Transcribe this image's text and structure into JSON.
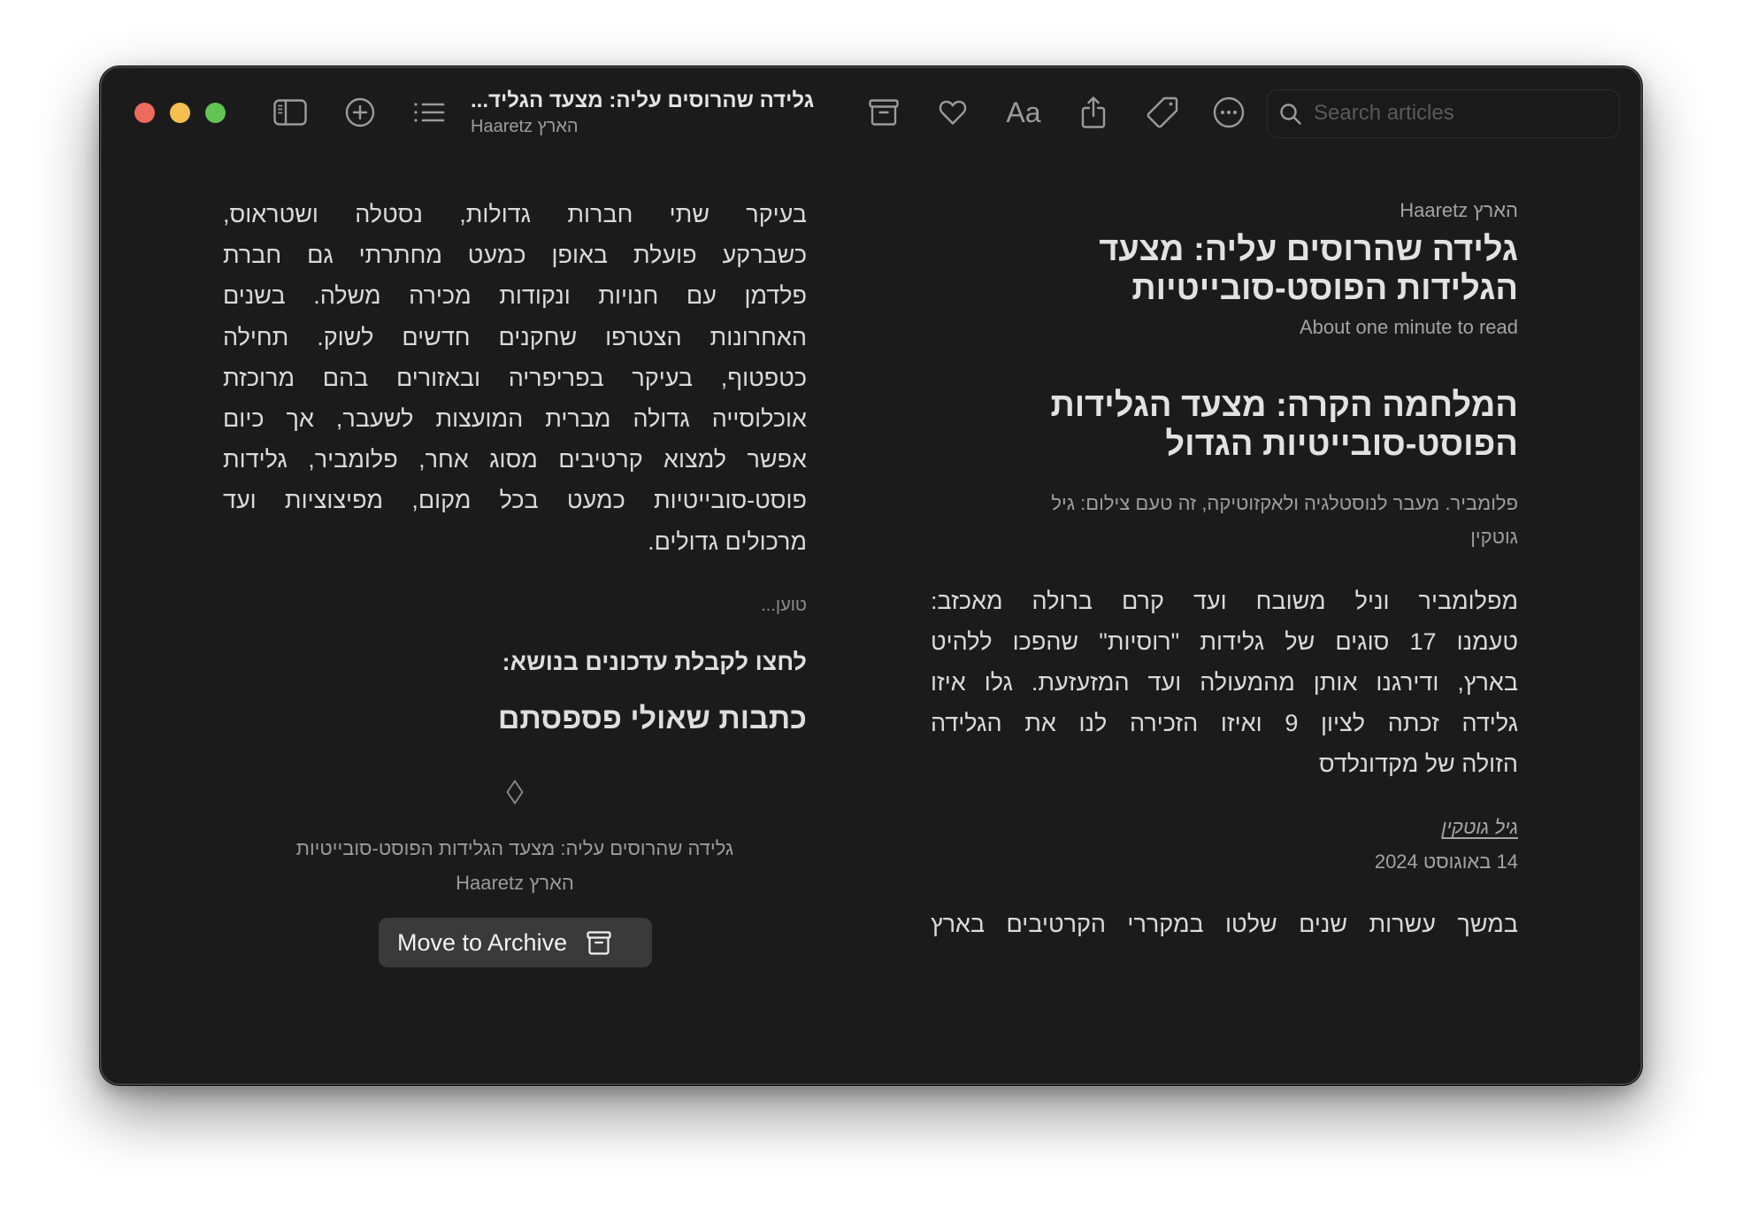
{
  "colors": {
    "window_bg": "#1b1b1b",
    "text_primary": "#dadada",
    "text_muted": "#9d9d9d",
    "icon": "#9b9b9b",
    "button_bg": "#3a3a3a",
    "traffic_close": "#ed6a5e",
    "traffic_minimize": "#f5bf4f",
    "traffic_zoom": "#61c554"
  },
  "toolbar": {
    "left_icons": [
      "sidebar-toggle-icon",
      "add-circle-icon",
      "list-icon"
    ],
    "title": "גלידה שהרוסים עליה: מצעד הגליד...",
    "subtitle": "הארץ Haaretz",
    "right_icons": [
      "archive-icon",
      "heart-icon",
      "text-size-icon",
      "share-icon",
      "tag-icon",
      "more-icon"
    ],
    "font_button_label": "Aa",
    "search": {
      "placeholder": "Search articles",
      "value": ""
    }
  },
  "article": {
    "source": "הארץ Haaretz",
    "title_lines": [
      "גלידה שהרוסים עליה: מצעד",
      "הגלידות הפוסט-סובייטיות"
    ],
    "read_time": "About one minute to read",
    "subheading_lines": [
      "המלחמה הקרה: מצעד הגלידות",
      "הפוסט-סובייטיות הגדול"
    ],
    "caption_lines": [
      "פלומביר. מעבר לנוסטלגיה ולאקזוטיקה, זה טעם צילום: גיל",
      "גוטקין"
    ],
    "intro_lines": [
      "מפלומביר וניל משובח ועד קרם ברולה מאכזב:",
      "טעמנו 17 סוגים של גלידות \"רוסיות\" שהפכו ללהיט",
      "בארץ, ודירגנו אותן מהמעולה ועד המזעזעת. גלו איזו",
      "גלידה זכתה לציון 9 ואיזו הזכירה לנו את הגלידה",
      "הזולה של מקדונלדס"
    ],
    "author": "גיל גוטקין",
    "date": "14 באוגוסט 2024",
    "body_lines": [
      "במשך עשרות שנים שלטו במקררי הקרטיבים בארץ",
      "בעיקר שתי חברות גדולות, נסטלה ושטראוס,",
      "כשברקע פועלת באופן כמעט מחתרתי גם חברת",
      "פלדמן עם חנויות ונקודות מכירה משלה. בשנים",
      "האחרונות הצטרפו שחקנים חדשים לשוק. תחילה",
      "כטפטוף, בעיקר בפריפריה ובאזורים בהם מרוכזת",
      "אוכלוסייה גדולה מברית המועצות לשעבר, אך כיום",
      "אפשר למצוא קרטיבים מסוג אחר, פלומביר, גלידות",
      "פוסט-סובייטיות כמעט בכל מקום, מפיצוציות ועד",
      "מרכולים גדולים."
    ]
  },
  "footer": {
    "loading": "טוען...",
    "subscribe_prompt": "לחצו לקבלת עדכונים בנושא:",
    "related_heading": "כתבות שאולי פספסתם",
    "divider_icon": "diamond-icon",
    "article_title": "גלידה שהרוסים עליה: מצעד הגלידות הפוסט-סובייטיות",
    "article_source": "הארץ Haaretz",
    "archive_button_label": "Move to Archive"
  }
}
